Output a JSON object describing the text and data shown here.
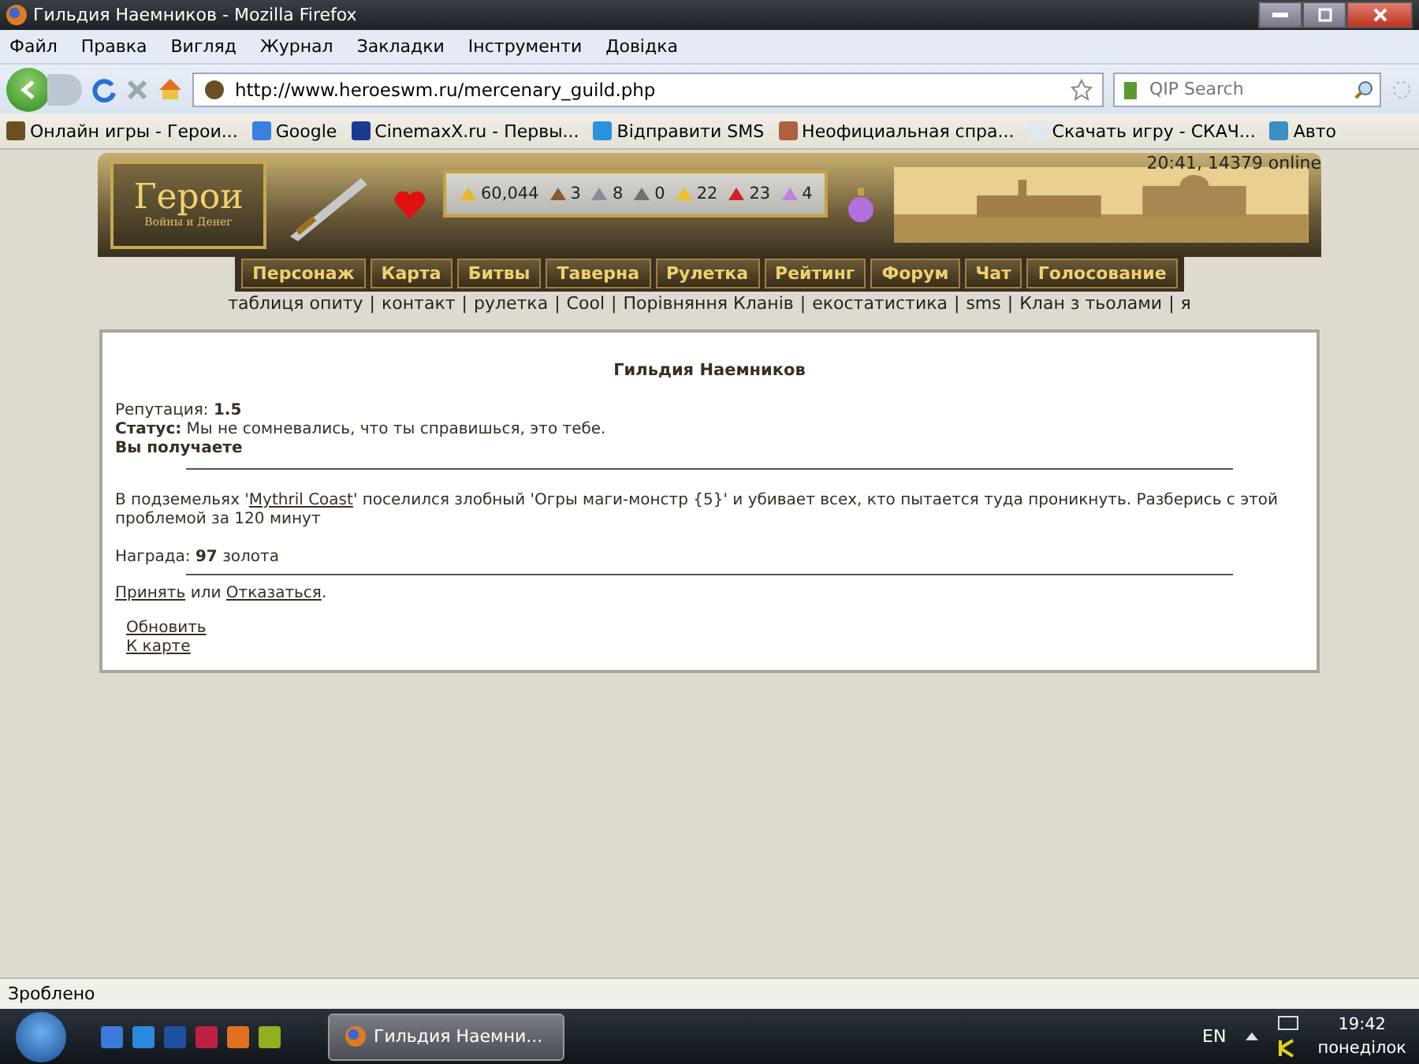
{
  "window": {
    "title": "Гильдия Наемников - Mozilla Firefox"
  },
  "menu": [
    "Файл",
    "Правка",
    "Вигляд",
    "Журнал",
    "Закладки",
    "Інструменти",
    "Довідка"
  ],
  "address": {
    "value": "http://www.heroeswm.ru/mercenary_guild.php"
  },
  "search": {
    "placeholder": "QIP Search"
  },
  "bookmarks": [
    {
      "label": "Онлайн игры - Герои..."
    },
    {
      "label": "Google"
    },
    {
      "label": "CinemaxX.ru - Первы..."
    },
    {
      "label": "Відправити SMS"
    },
    {
      "label": "Неофициальная спра..."
    },
    {
      "label": "Скачать игру - СКАЧ..."
    },
    {
      "label": "Авто"
    }
  ],
  "header": {
    "logo_title": "Герои",
    "logo_subtitle": "Войны и Денег",
    "online": "20:41, 14379 online",
    "resources": [
      "60,044",
      "3",
      "8",
      "0",
      "22",
      "23",
      "4"
    ],
    "nav": [
      "Персонаж",
      "Карта",
      "Битвы",
      "Таверна",
      "Рулетка",
      "Рейтинг",
      "Форум",
      "Чат",
      "Голосование"
    ],
    "separator": "|",
    "sublinks": [
      "таблиця опиту",
      "контакт",
      "рулетка",
      "Cool",
      "Порівняння Кланів",
      "екостатистика",
      "sms",
      "Клан з тьолами",
      "я"
    ]
  },
  "guild": {
    "title": "Гильдия Наемников",
    "reputation": "Репутация: **1.5**",
    "status": "**Статус:** Мы не сомневались, что ты справишься, это тебе.",
    "receive": "Вы получаете",
    "quest_before": "В подземельях '",
    "quest_link": "Mythril Coast",
    "quest_after": "' поселился злобный 'Огры маги-монстр {5}' и убивает всех, кто пытается туда проникнуть. Разберись с этой проблемой за 120 минут",
    "reward": "Награда: **97** золота",
    "accept": "Принять",
    "or": " или ",
    "decline": "Отказаться",
    "period": ".",
    "links": [
      "Обновить",
      "К карте"
    ]
  },
  "status_bar": "Зроблено",
  "taskbar": {
    "task": "Гильдия Наемни...",
    "language": "EN",
    "time": "19:42",
    "day": "понеділок"
  }
}
